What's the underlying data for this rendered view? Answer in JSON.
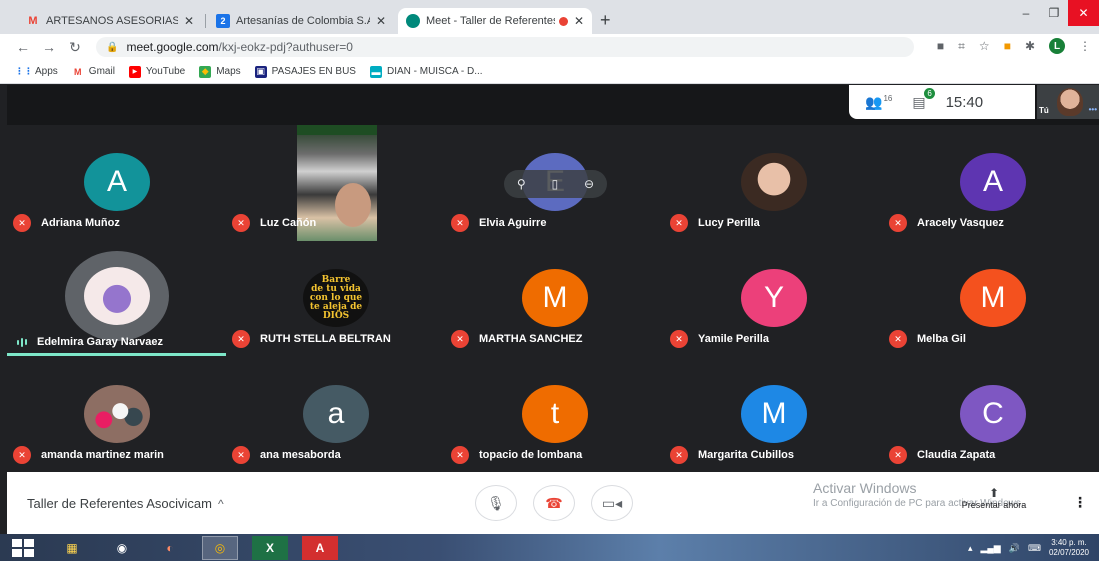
{
  "browser": {
    "tabs": [
      {
        "title": "ARTESANOS ASESORIAS PUNTUA",
        "favicon": "M",
        "color": "#ea4335"
      },
      {
        "title": "Artesanías de Colombia S.A. - Ca",
        "favicon": "2",
        "color": "#1a73e8"
      },
      {
        "title": "Meet - Taller de Referentes A",
        "favicon": "meet-icon",
        "color": "#00897b"
      }
    ],
    "url_host": "meet.google.com",
    "url_path": "/kxj-eokz-pdj?authuser=0",
    "profile_initial": "L",
    "bookmarks": [
      {
        "label": "Apps"
      },
      {
        "label": "Gmail"
      },
      {
        "label": "YouTube"
      },
      {
        "label": "Maps"
      },
      {
        "label": "PASAJES EN BUS"
      },
      {
        "label": "DIAN - MUISCA - D..."
      }
    ]
  },
  "meet": {
    "participants_count": "16",
    "chat_count": "6",
    "time": "15:40",
    "self_label": "Tú",
    "meeting_title": "Taller de Referentes Asocivicam",
    "present_label": "Presentar ahora",
    "activate_title": "Activar Windows",
    "activate_sub": "Ir a Configuración de PC para activar Windows.",
    "participants": [
      {
        "name": "Adriana Muñoz",
        "initial": "A",
        "color": "#12939a"
      },
      {
        "name": "Luz Cañón",
        "initial": "",
        "color": ""
      },
      {
        "name": "Elvia Aguirre",
        "initial": "E",
        "color": "#5c6bc0"
      },
      {
        "name": "Lucy Perilla",
        "initial": "",
        "color": "#8d6e63"
      },
      {
        "name": "Aracely Vasquez",
        "initial": "A",
        "color": "#5e35b1"
      },
      {
        "name": "Edelmira Garay Narvaez",
        "initial": "",
        "color": "#e0e0e0"
      },
      {
        "name": "RUTH STELLA BELTRAN",
        "initial": "",
        "color": "#111111"
      },
      {
        "name": "MARTHA SANCHEZ",
        "initial": "M",
        "color": "#ef6c00"
      },
      {
        "name": "Yamile Perilla",
        "initial": "Y",
        "color": "#ec407a"
      },
      {
        "name": "Melba Gil",
        "initial": "M",
        "color": "#f4511e"
      },
      {
        "name": "amanda martinez marin",
        "initial": "",
        "color": "#6d4c41"
      },
      {
        "name": "ana mesaborda",
        "initial": "a",
        "color": "#455a64"
      },
      {
        "name": "topacio de lombana",
        "initial": "t",
        "color": "#ef6c00"
      },
      {
        "name": "Margarita Cubillos",
        "initial": "M",
        "color": "#1e88e5"
      },
      {
        "name": "Claudia Zapata",
        "initial": "C",
        "color": "#7e57c2"
      }
    ],
    "ruth_avatar_text": [
      "Barre",
      "de tu vida",
      "con lo que",
      "te aleja de",
      "DIOS"
    ]
  },
  "taskbar": {
    "clock_time": "3:40 p. m.",
    "clock_date": "02/07/2020"
  }
}
